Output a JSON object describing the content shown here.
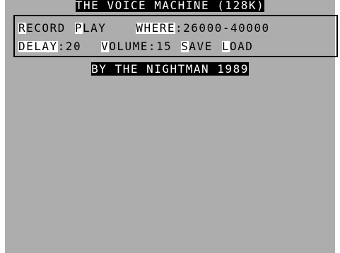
{
  "title": "THE VOICE MACHINE (128K)",
  "menu": {
    "record": {
      "key": "R",
      "rest": "ECORD"
    },
    "play": {
      "key": "P",
      "rest": "LAY"
    },
    "where": {
      "key": "WHERE",
      "rest": ":26000-40000"
    },
    "delay": {
      "key": "DELAY",
      "rest": ":20"
    },
    "volume": {
      "key": "V",
      "rest": "OLUME:15"
    },
    "save": {
      "key": "S",
      "rest": "AVE"
    },
    "load": {
      "key": "L",
      "rest": "OAD"
    }
  },
  "credit": "BY THE NIGHTMAN 1989",
  "colors": {
    "background": "#adadad",
    "ink": "#000000",
    "paper_highlight": "#ffffff"
  }
}
